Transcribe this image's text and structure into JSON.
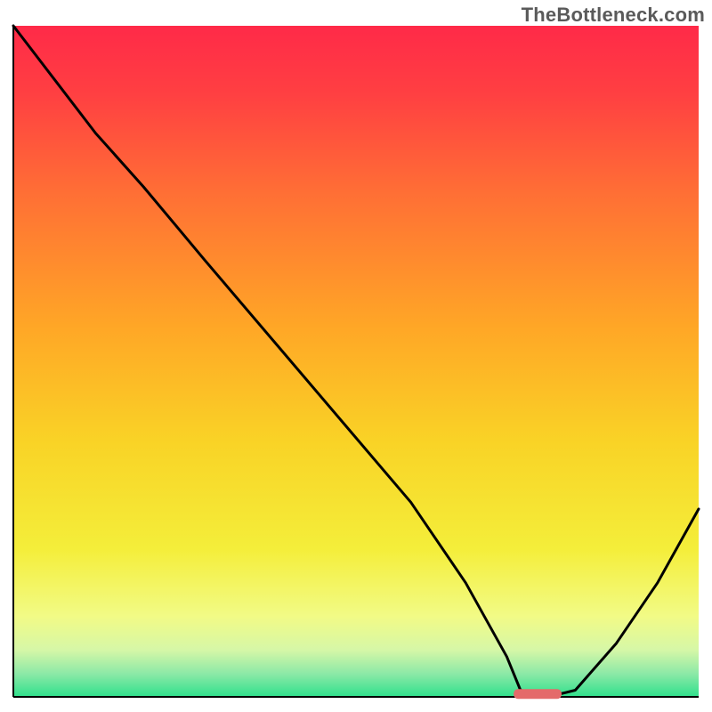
{
  "watermark": "TheBottleneck.com",
  "chart_data": {
    "type": "line",
    "title": "",
    "xlabel": "",
    "ylabel": "",
    "xlim": [
      0,
      100
    ],
    "ylim": [
      0,
      100
    ],
    "gradient": [
      {
        "offset": 0.0,
        "color": "#ff2a48"
      },
      {
        "offset": 0.1,
        "color": "#ff3f42"
      },
      {
        "offset": 0.25,
        "color": "#ff6f35"
      },
      {
        "offset": 0.45,
        "color": "#ffa726"
      },
      {
        "offset": 0.62,
        "color": "#f9d326"
      },
      {
        "offset": 0.78,
        "color": "#f4ee3a"
      },
      {
        "offset": 0.88,
        "color": "#f2fb86"
      },
      {
        "offset": 0.93,
        "color": "#d6f7a7"
      },
      {
        "offset": 0.965,
        "color": "#8de9a7"
      },
      {
        "offset": 1.0,
        "color": "#2fe08c"
      }
    ],
    "series": [
      {
        "name": "bottleneck-curve",
        "x": [
          0,
          6,
          12,
          19,
          28,
          38,
          48,
          58,
          66,
          72,
          74,
          78,
          82,
          88,
          94,
          100
        ],
        "y": [
          100,
          92,
          84,
          76,
          65,
          53,
          41,
          29,
          17,
          6,
          1,
          0,
          1,
          8,
          17,
          28
        ]
      }
    ],
    "marker": {
      "x_start": 73,
      "x_end": 80,
      "y": 0.5
    },
    "colors": {
      "curve": "#000000",
      "marker": "#e46a6a"
    }
  }
}
